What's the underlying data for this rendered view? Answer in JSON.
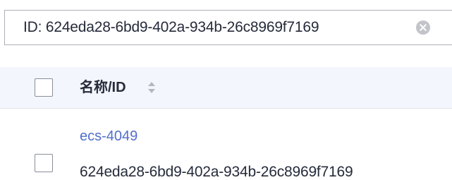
{
  "search": {
    "query": "ID:  624eda28-6bd9-402a-934b-26c8969f7169",
    "clear_icon": "close-circle-icon"
  },
  "table": {
    "header": {
      "name_column": "名称/ID",
      "sort_icon": "sort-icon"
    },
    "rows": [
      {
        "name": "ecs-4049",
        "id": "624eda28-6bd9-402a-934b-26c8969f7169",
        "checked": false
      }
    ]
  },
  "colors": {
    "link": "#526ecc",
    "header_bg": "#f3f6fc",
    "text": "#252b3a",
    "border": "#adb0b8"
  }
}
